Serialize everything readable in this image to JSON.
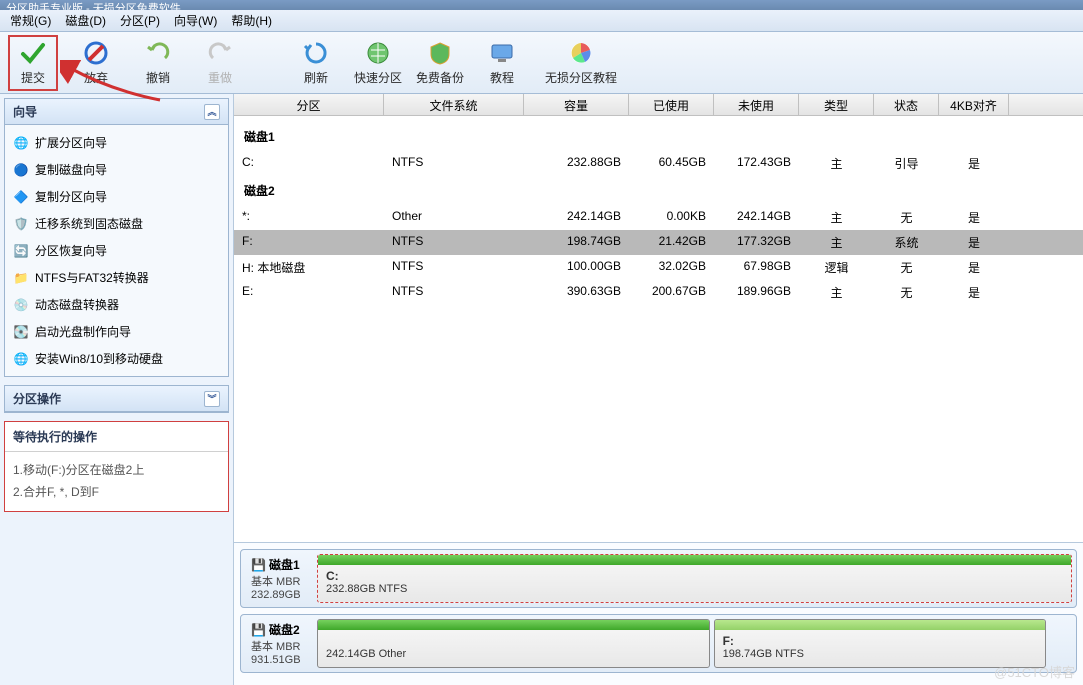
{
  "title": "分区助手专业版 - 无损分区免费软件",
  "menu": [
    "常规(G)",
    "磁盘(D)",
    "分区(P)",
    "向导(W)",
    "帮助(H)"
  ],
  "toolbar": {
    "commit": "提交",
    "discard": "放弃",
    "undo": "撤销",
    "redo": "重做",
    "refresh": "刷新",
    "quick": "快速分区",
    "backup": "免费备份",
    "tutorial": "教程",
    "lossless": "无损分区教程"
  },
  "sidebar": {
    "wizard_title": "向导",
    "wizards": [
      "扩展分区向导",
      "复制磁盘向导",
      "复制分区向导",
      "迁移系统到固态磁盘",
      "分区恢复向导",
      "NTFS与FAT32转换器",
      "动态磁盘转换器",
      "启动光盘制作向导",
      "安装Win8/10到移动硬盘"
    ],
    "ops_title": "分区操作",
    "pending_title": "等待执行的操作",
    "pending": [
      "1.移动(F:)分区在磁盘2上",
      "2.合并F, *, D到F"
    ]
  },
  "grid": {
    "headers": [
      "分区",
      "文件系统",
      "容量",
      "已使用",
      "未使用",
      "类型",
      "状态",
      "4KB对齐"
    ],
    "disks": [
      {
        "label": "磁盘1",
        "rows": [
          {
            "part": "C:",
            "fs": "NTFS",
            "cap": "232.88GB",
            "used": "60.45GB",
            "free": "172.43GB",
            "type": "主",
            "state": "引导",
            "align": "是",
            "sel": false
          }
        ]
      },
      {
        "label": "磁盘2",
        "rows": [
          {
            "part": "*:",
            "fs": "Other",
            "cap": "242.14GB",
            "used": "0.00KB",
            "free": "242.14GB",
            "type": "主",
            "state": "无",
            "align": "是",
            "sel": false
          },
          {
            "part": "F:",
            "fs": "NTFS",
            "cap": "198.74GB",
            "used": "21.42GB",
            "free": "177.32GB",
            "type": "主",
            "state": "系统",
            "align": "是",
            "sel": true
          },
          {
            "part": "H: 本地磁盘",
            "fs": "NTFS",
            "cap": "100.00GB",
            "used": "32.02GB",
            "free": "67.98GB",
            "type": "逻辑",
            "state": "无",
            "align": "是",
            "sel": false
          },
          {
            "part": "E:",
            "fs": "NTFS",
            "cap": "390.63GB",
            "used": "200.67GB",
            "free": "189.96GB",
            "type": "主",
            "state": "无",
            "align": "是",
            "sel": false
          }
        ]
      }
    ]
  },
  "diskmaps": [
    {
      "name": "磁盘1",
      "sub1": "基本 MBR",
      "sub2": "232.89GB",
      "parts": [
        {
          "label": "C:",
          "info": "232.88GB NTFS",
          "pct": 100,
          "cls": "",
          "sel": true
        }
      ]
    },
    {
      "name": "磁盘2",
      "sub1": "基本 MBR",
      "sub2": "931.51GB",
      "parts": [
        {
          "label": "",
          "info": "242.14GB Other",
          "pct": 52,
          "cls": "",
          "sel": false
        },
        {
          "label": "F:",
          "info": "198.74GB NTFS",
          "pct": 44,
          "cls": "f",
          "sel": false
        }
      ]
    }
  ],
  "watermark": "@51CTO博客"
}
